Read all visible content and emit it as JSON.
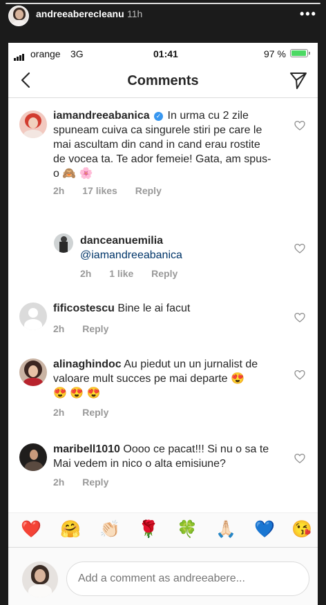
{
  "story": {
    "username": "andreeaberecleanu",
    "time": "11h",
    "more": "•••"
  },
  "status_bar": {
    "carrier": "orange",
    "network": "3G",
    "time": "01:41",
    "battery": "97 %",
    "battery_level": 0.97
  },
  "header": {
    "title": "Comments"
  },
  "comments": [
    {
      "username": "iamandreeabanica",
      "verified": true,
      "text": "In urma cu 2 zile spuneam cuiva ca singurele stiri pe care le mai ascultam din cand in cand erau rostite de vocea ta. Te ador femeie! Gata, am spus-o",
      "emoji": "🙈 🌸",
      "time": "2h",
      "likes": "17 likes",
      "reply": "Reply"
    },
    {
      "username": "danceanuemilia",
      "mention": "@iamandreeabanica",
      "time": "2h",
      "likes": "1 like",
      "reply": "Reply"
    },
    {
      "username": "fificostescu",
      "text": "Bine le ai facut",
      "time": "2h",
      "reply": "Reply"
    },
    {
      "username": "alinaghindoc",
      "text": "Au piedut un un jurnalist de valoare mult succes pe mai departe",
      "emoji1": "😍",
      "emoji2": "😍 😍 😍",
      "time": "2h",
      "reply": "Reply"
    },
    {
      "username": "maribell1010",
      "text": "Oooo ce pacat!!! Si nu o sa te Mai vedem in nico o alta emisiune?",
      "time": "2h",
      "reply": "Reply"
    }
  ],
  "reactions": [
    "❤️",
    "🤗",
    "👏🏻",
    "🌹",
    "🍀",
    "🙏🏻",
    "💙",
    "😘"
  ],
  "composer": {
    "placeholder": "Add a comment as andreeabere..."
  },
  "colors": {
    "accent": "#3897f0",
    "text": "#262626",
    "meta": "#999999",
    "battery": "#4cd964"
  }
}
